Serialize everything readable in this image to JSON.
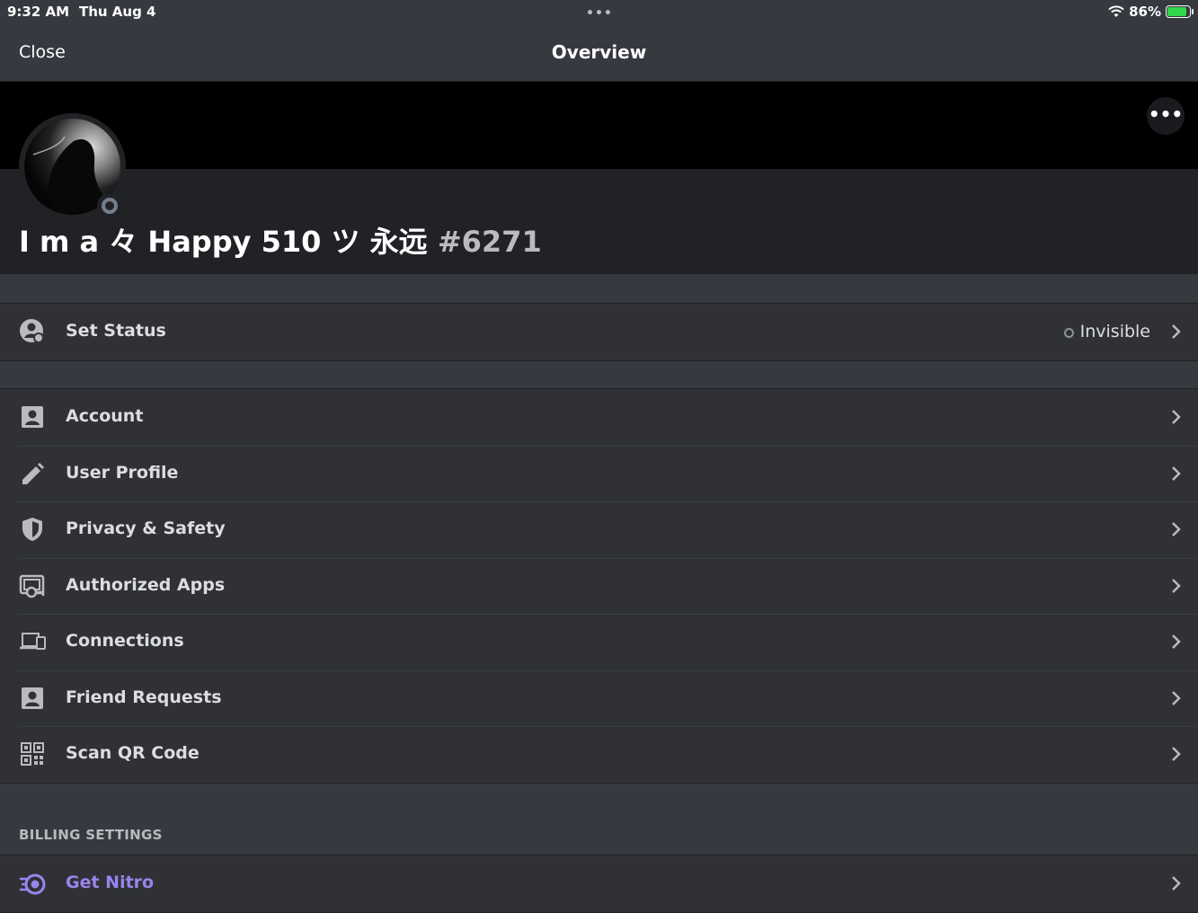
{
  "status_bar": {
    "time": "9:32 AM",
    "date": "Thu Aug 4",
    "battery": "86%",
    "battery_level": 0.86,
    "multitask_dots": "•••"
  },
  "nav": {
    "close_label": "Close",
    "title": "Overview"
  },
  "banner": {
    "more_label": "•••"
  },
  "profile": {
    "name": "I m a 々 Happy 510 ツ 永远 ",
    "discriminator": "#6271",
    "status": "invisible"
  },
  "status_row": {
    "label": "Set Status",
    "value": "Invisible"
  },
  "user_settings": [
    {
      "label": "Account",
      "icon": "account-icon"
    },
    {
      "label": "User Profile",
      "icon": "pencil-icon"
    },
    {
      "label": "Privacy & Safety",
      "icon": "shield-icon"
    },
    {
      "label": "Authorized Apps",
      "icon": "authorized-apps-icon"
    },
    {
      "label": "Connections",
      "icon": "devices-icon"
    },
    {
      "label": "Friend Requests",
      "icon": "friend-requests-icon"
    },
    {
      "label": "Scan QR Code",
      "icon": "qr-code-icon"
    }
  ],
  "billing": {
    "header": "BILLING SETTINGS",
    "items": [
      {
        "label": "Get Nitro",
        "icon": "nitro-icon"
      }
    ]
  },
  "colors": {
    "background": "#36393f",
    "row_background": "#2f3136",
    "header_dark": "#202225",
    "nitro": "#9b84ec",
    "text": "#dcddde"
  }
}
